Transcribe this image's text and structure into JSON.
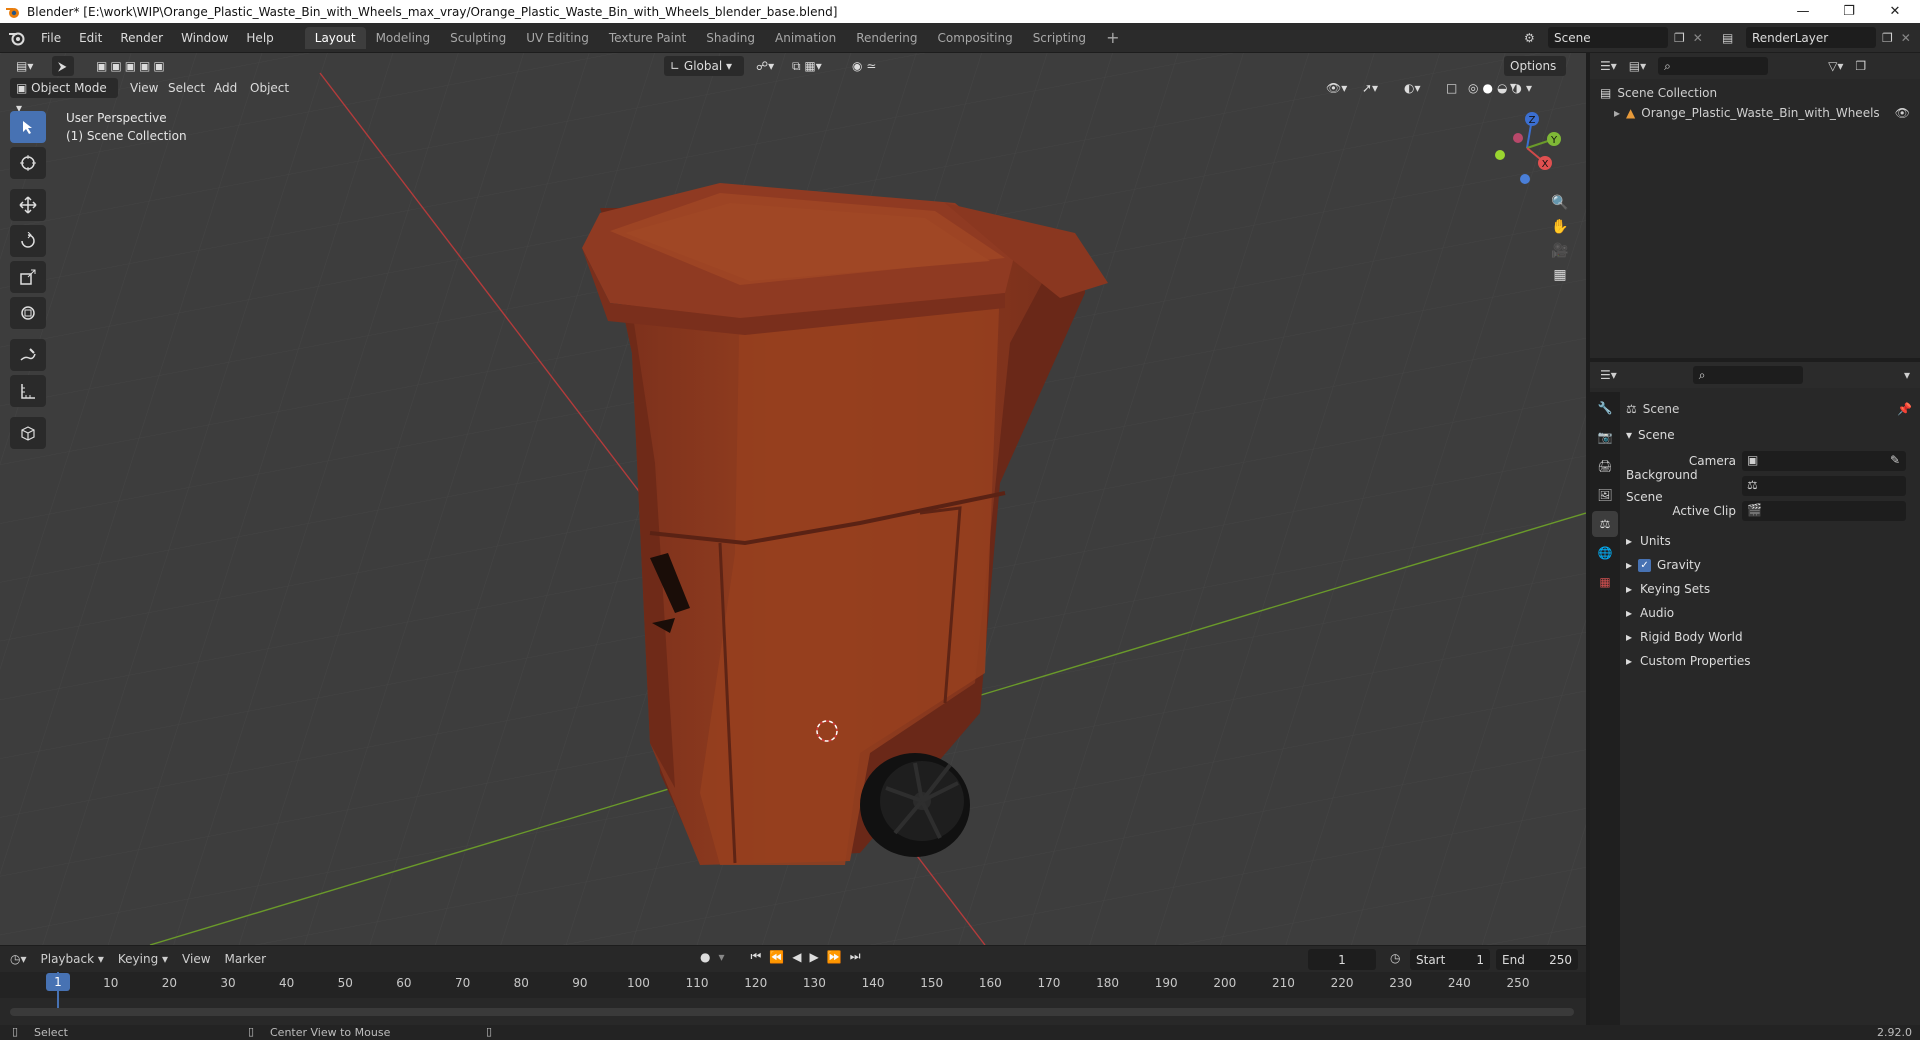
{
  "window": {
    "title": "Blender* [E:\\work\\WIP\\Orange_Plastic_Waste_Bin_with_Wheels_max_vray/Orange_Plastic_Waste_Bin_with_Wheels_blender_base.blend]"
  },
  "menu": [
    "File",
    "Edit",
    "Render",
    "Window",
    "Help"
  ],
  "workspaces": [
    "Layout",
    "Modeling",
    "Sculpting",
    "UV Editing",
    "Texture Paint",
    "Shading",
    "Animation",
    "Rendering",
    "Compositing",
    "Scripting"
  ],
  "active_workspace": "Layout",
  "scene_field": "Scene",
  "renderlayer_field": "RenderLayer",
  "viewport": {
    "mode": "Object Mode",
    "menus": [
      "View",
      "Select",
      "Add",
      "Object"
    ],
    "transform_orientation": "Global",
    "options_label": "Options",
    "overlay_title": "User Perspective",
    "overlay_sub": "(1) Scene Collection",
    "gizmo_axes": {
      "z": "Z",
      "y": "Y",
      "x": "X"
    }
  },
  "outliner": {
    "root": "Scene Collection",
    "items": [
      "Orange_Plastic_Waste_Bin_with_Wheels"
    ]
  },
  "properties": {
    "context_label": "Scene",
    "panel_title": "Scene",
    "fields": [
      {
        "label": "Camera"
      },
      {
        "label": "Background Scene"
      },
      {
        "label": "Active Clip"
      }
    ],
    "sections": [
      "Units",
      "Gravity",
      "Keying Sets",
      "Audio",
      "Rigid Body World",
      "Custom Properties"
    ]
  },
  "timeline": {
    "menus": [
      "Playback",
      "Keying",
      "View",
      "Marker"
    ],
    "current_frame": "1",
    "start_label": "Start",
    "start_value": "1",
    "end_label": "End",
    "end_value": "250",
    "ticks": [
      "1",
      "10",
      "20",
      "30",
      "40",
      "50",
      "60",
      "70",
      "80",
      "90",
      "100",
      "110",
      "120",
      "130",
      "140",
      "150",
      "160",
      "170",
      "180",
      "190",
      "200",
      "210",
      "220",
      "230",
      "240",
      "250"
    ]
  },
  "status": {
    "left": "Select",
    "middle": "Center View to Mouse",
    "version": "2.92.0"
  },
  "colors": {
    "bin": "#8f3a22",
    "accent": "#4772b3",
    "axis_x": "#b33b3b",
    "axis_y": "#6a9a2a"
  }
}
